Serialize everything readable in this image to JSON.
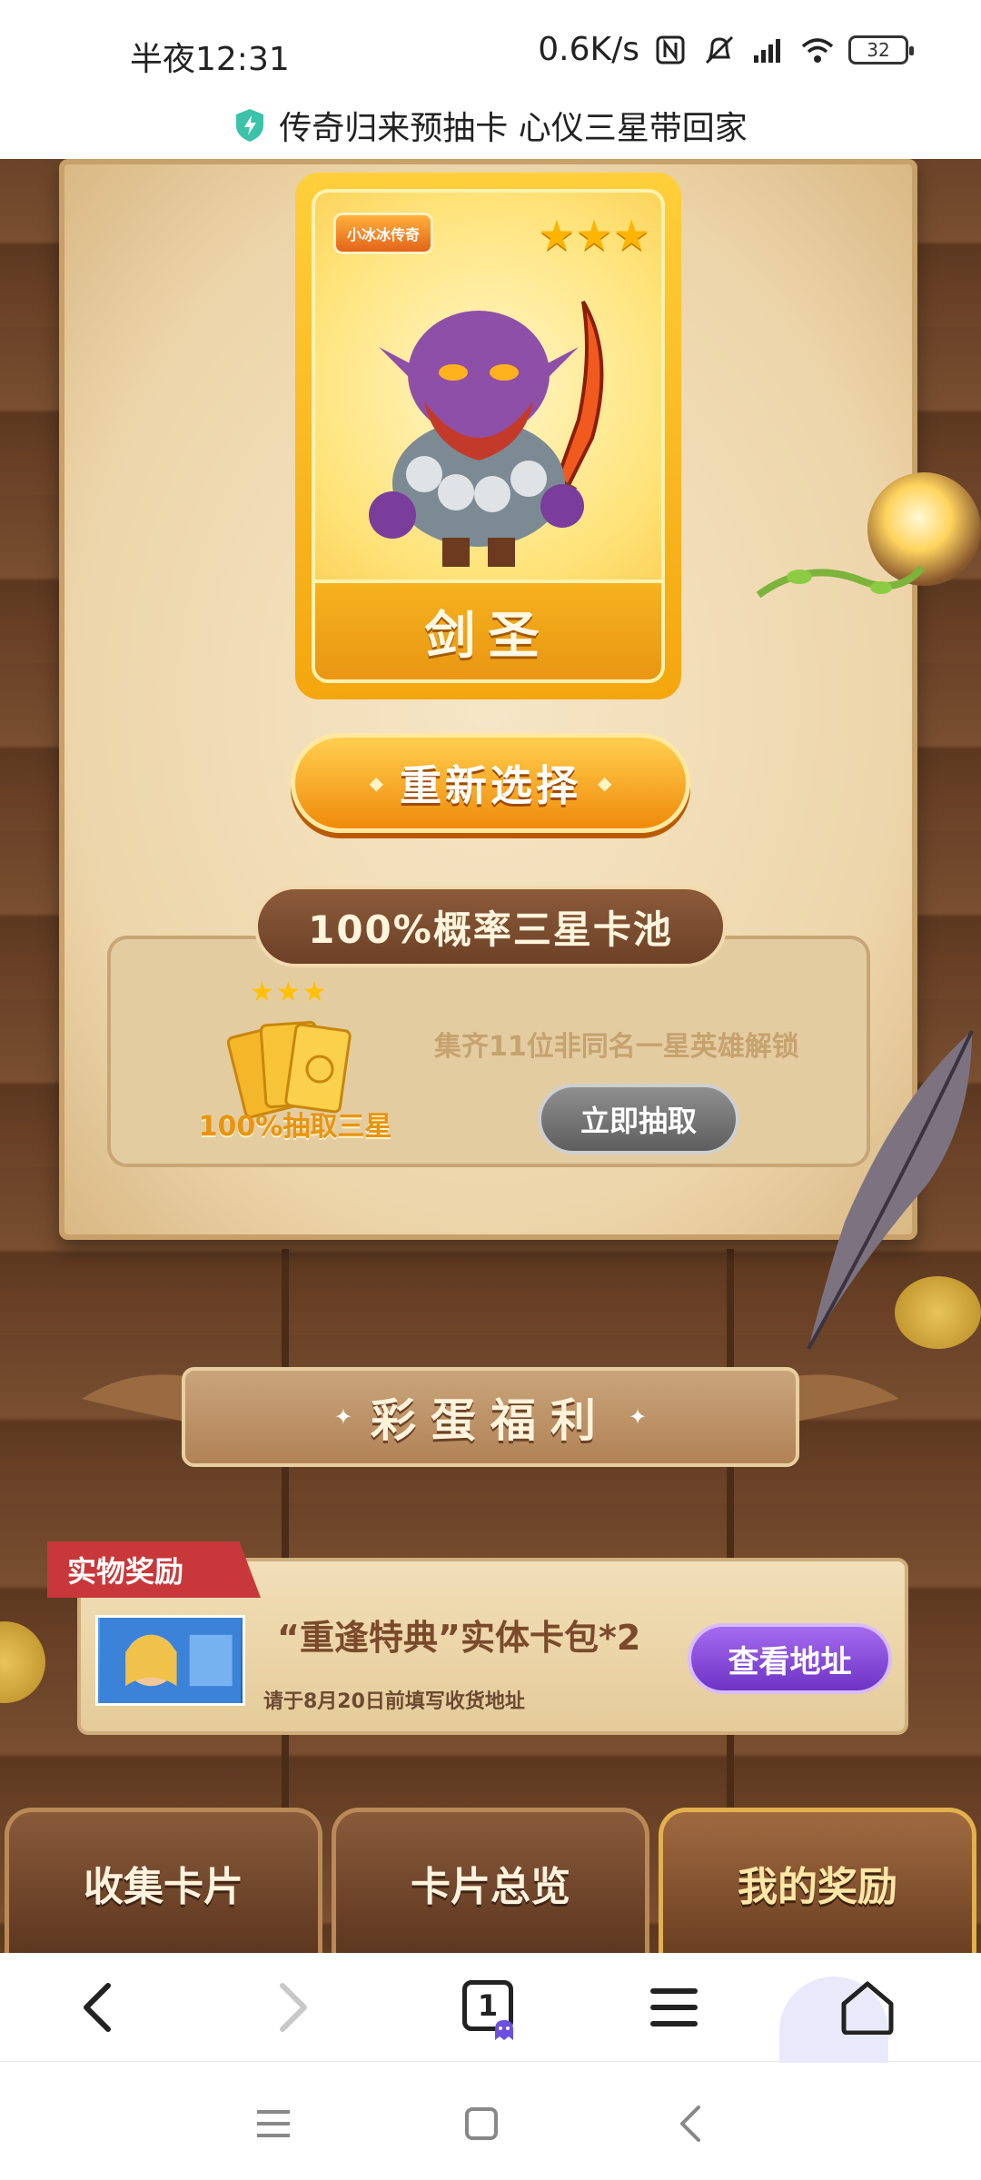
{
  "status_bar": {
    "time": "半夜12:31",
    "speed": "0.6K/s",
    "battery": "32"
  },
  "header": {
    "title": "传奇归来预抽卡 心仪三星带回家"
  },
  "hero_card": {
    "logo_text": "小冰冰传奇",
    "stars": "★★★",
    "name": "剑圣"
  },
  "reselect_button": {
    "label": "重新选择"
  },
  "pool": {
    "title": "100%概率三星卡池",
    "stars": "★★★",
    "left_label": "100%抽取三星",
    "description": "集齐11位非同名一星英雄解锁",
    "draw_button": "立即抽取"
  },
  "easter_egg": {
    "title": "彩蛋福利"
  },
  "physical_reward": {
    "tag": "实物奖励",
    "title": "“重逢特典”实体卡包*2",
    "note": "请于8月20日前填写收货地址",
    "address_button": "查看地址"
  },
  "game_tabs": [
    {
      "label": "收集卡片"
    },
    {
      "label": "卡片总览"
    },
    {
      "label": "我的奖励"
    }
  ],
  "browser_bar": {
    "tab_count": "1"
  },
  "colors": {
    "gold": "#f4a60e",
    "wood": "#6a4328",
    "parchment": "#f6e6c7",
    "purple_button": "#6d33c4",
    "red_tag": "#c8383a"
  }
}
